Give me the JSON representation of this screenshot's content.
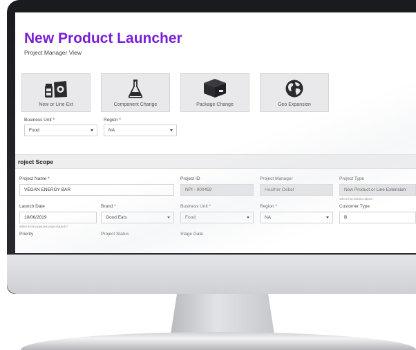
{
  "app": {
    "title": "New Product Launcher",
    "subtitle": "Project Manager View"
  },
  "tiles": [
    {
      "label": "New or Line Ext",
      "icon": "snack-products-icon"
    },
    {
      "label": "Component Change",
      "icon": "flask-icon"
    },
    {
      "label": "Package Change",
      "icon": "box-icon"
    },
    {
      "label": "Geo Expansion",
      "icon": "globe-icon"
    }
  ],
  "top_filters": {
    "business_unit": {
      "label": "Business Unit *",
      "value": "Food"
    },
    "region": {
      "label": "Region *",
      "value": "NA"
    }
  },
  "project_scope": {
    "section_title": "roject Scope",
    "project_name": {
      "label": "Project Name *",
      "value": "VEGAN ENERGY BAR"
    },
    "project_id": {
      "label": "Project ID",
      "value": "NPI - 000459"
    },
    "project_manager": {
      "label": "Project Manager",
      "value": "Heather Oebel"
    },
    "project_type": {
      "label": "Project Type",
      "value": "New Product or Line Extension",
      "hint": "select from buttons above"
    },
    "launch_date": {
      "label": "Launch Date",
      "value": "10/06/2019",
      "hint": "When is the expected project launch?"
    },
    "brand": {
      "label": "Brand *",
      "value": "Good Eats"
    },
    "business_unit": {
      "label": "Business Unit *",
      "value": "Food"
    },
    "region": {
      "label": "Region *",
      "value": "NA"
    },
    "customer_type": {
      "label": "Customer Type",
      "value": "B"
    },
    "priority": {
      "label": "Priority"
    },
    "project_status": {
      "label": "Project Status"
    },
    "stage_gate": {
      "label": "Stage Gate"
    }
  },
  "colors": {
    "title_purple": "#7a1fd6",
    "tile_bg": "#e9e9ec",
    "readonly_bg": "#e2e2e5"
  }
}
